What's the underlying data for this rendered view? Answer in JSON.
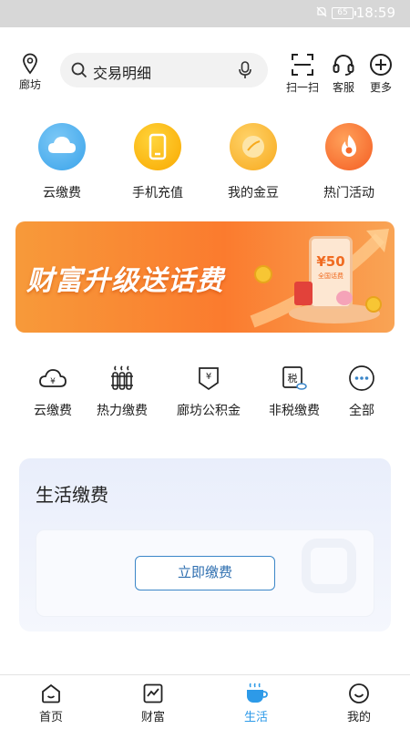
{
  "status_bar": {
    "battery": "65",
    "time": "18:59"
  },
  "top_bar": {
    "location": "廊坊",
    "search_text": "交易明细",
    "tools": [
      {
        "label": "扫一扫",
        "icon": "scan-icon"
      },
      {
        "label": "客服",
        "icon": "headset-icon"
      },
      {
        "label": "更多",
        "icon": "plus-circle-icon"
      }
    ]
  },
  "quick_entries": [
    {
      "label": "云缴费",
      "icon": "cloud-icon",
      "color": "#3aa3ea"
    },
    {
      "label": "手机充值",
      "icon": "phone-icon",
      "color": "#f9b400"
    },
    {
      "label": "我的金豆",
      "icon": "bean-icon",
      "color": "#f7b128"
    },
    {
      "label": "热门活动",
      "icon": "flame-icon",
      "color": "#f76a2b"
    }
  ],
  "banner": {
    "title": "财富升级送话费",
    "amount": "¥50",
    "amount_caption": "全国话费"
  },
  "services": [
    {
      "label": "云缴费",
      "icon": "cloud-yen-icon"
    },
    {
      "label": "热力缴费",
      "icon": "heating-icon"
    },
    {
      "label": "廊坊公积金",
      "icon": "fund-icon"
    },
    {
      "label": "非税缴费",
      "icon": "tax-icon"
    },
    {
      "label": "全部",
      "icon": "more-dots-icon"
    }
  ],
  "life_payment": {
    "title": "生活缴费",
    "button": "立即缴费"
  },
  "tab_bar": {
    "active_color": "#2d9ae8",
    "tabs": [
      {
        "label": "首页",
        "icon": "home-icon"
      },
      {
        "label": "财富",
        "icon": "chart-icon"
      },
      {
        "label": "生活",
        "icon": "cup-icon",
        "active": true
      },
      {
        "label": "我的",
        "icon": "smile-icon"
      }
    ]
  }
}
